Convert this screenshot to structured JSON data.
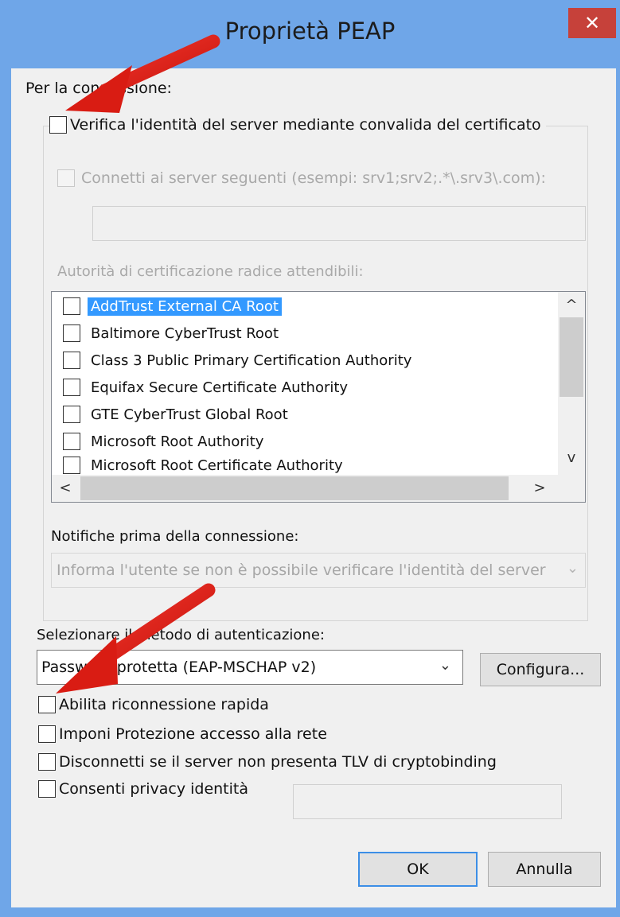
{
  "window": {
    "title": "Proprietà PEAP",
    "close_glyph": "✕"
  },
  "connection": {
    "heading": "Per la connessione:",
    "verify_server_label": "Verifica l'identità del server mediante convalida del certificato",
    "verify_server_checked": false,
    "connect_servers_label": "Connetti ai server seguenti (esempi: srv1;srv2;.*\\.srv3\\.com):",
    "connect_servers_value": "",
    "trusted_ca_label": "Autorità di certificazione radice attendibili:",
    "ca_list": [
      {
        "label": "AddTrust External CA Root",
        "selected": true
      },
      {
        "label": "Baltimore CyberTrust Root",
        "selected": false
      },
      {
        "label": "Class 3 Public Primary Certification Authority",
        "selected": false
      },
      {
        "label": "Equifax Secure Certificate Authority",
        "selected": false
      },
      {
        "label": "GTE CyberTrust Global Root",
        "selected": false
      },
      {
        "label": "Microsoft Root Authority",
        "selected": false
      },
      {
        "label": "Microsoft Root Certificate Authority",
        "selected": false
      }
    ],
    "scroll_glyphs": {
      "up": "^",
      "down": "v",
      "left": "<",
      "right": ">"
    },
    "notify_label": "Notifiche prima della connessione:",
    "notify_value": "Informa l'utente se non è possibile verificare l'identità del server"
  },
  "auth": {
    "method_label": "Selezionare il metodo di autenticazione:",
    "method_value": "Password protetta (EAP-MSCHAP v2)",
    "configure_label": "Configura...",
    "options": [
      {
        "label": "Abilita riconnessione rapida",
        "checked": false
      },
      {
        "label": "Imponi Protezione accesso alla rete",
        "checked": false
      },
      {
        "label": "Disconnetti se il server non presenta TLV di cryptobinding",
        "checked": false
      },
      {
        "label": "Consenti privacy identità",
        "checked": false
      }
    ],
    "privacy_value": ""
  },
  "buttons": {
    "ok": "OK",
    "cancel": "Annulla"
  },
  "colors": {
    "title_bar": "#6fa6e8",
    "close_button": "#c6413a",
    "selection": "#3399ff",
    "annotation_arrow": "#e2231a"
  },
  "dropdown_glyph": "⌄"
}
